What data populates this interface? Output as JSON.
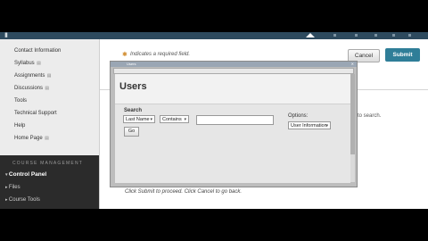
{
  "sidebar": {
    "items": [
      {
        "label": "Contact Information",
        "chevron": false
      },
      {
        "label": "Syllabus",
        "chevron": true
      },
      {
        "label": "Assignments",
        "chevron": true
      },
      {
        "label": "Discussions",
        "chevron": true
      },
      {
        "label": "Tools",
        "chevron": false
      },
      {
        "label": "Technical Support",
        "chevron": false
      },
      {
        "label": "Help",
        "chevron": false
      },
      {
        "label": "Home Page",
        "chevron": true
      }
    ],
    "section_header": "COURSE MANAGEMENT",
    "control_panel": "Control Panel",
    "sub_items": [
      "Files",
      "Course Tools"
    ]
  },
  "form": {
    "required_note": "Indicates a required field.",
    "cancel_label": "Cancel",
    "submit_label": "Submit",
    "right_snippet": "to search.",
    "bottom_note": "Click Submit to proceed. Click Cancel to go back."
  },
  "popup": {
    "title": "Users",
    "search_label": "Search",
    "field_select": "Last Name",
    "operator_select": "Contains",
    "search_value": "",
    "go_label": "Go",
    "options_label": "Options:",
    "options_select": "User Information"
  },
  "colors": {
    "topbar": "#2d4a5e",
    "submit": "#2f7e98"
  },
  "icons": {
    "required": "asterisk-icon",
    "dropdown": "chevron-down-icon"
  }
}
